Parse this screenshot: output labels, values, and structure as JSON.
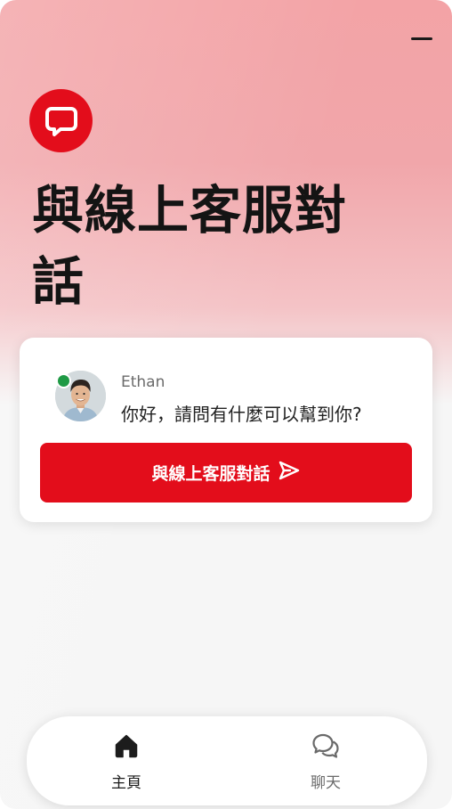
{
  "header": {
    "title": "與線上客服對話"
  },
  "agent_card": {
    "agent_name": "Ethan",
    "greeting": "你好，請問有什麼可以幫到你?",
    "start_button_label": "與線上客服對話"
  },
  "bottom_nav": {
    "items": [
      {
        "label": "主頁",
        "icon": "home-icon",
        "active": true
      },
      {
        "label": "聊天",
        "icon": "chat-bubbles-icon",
        "active": false
      }
    ]
  },
  "colors": {
    "brand": "#e30d1b",
    "online": "#1f9a45"
  }
}
